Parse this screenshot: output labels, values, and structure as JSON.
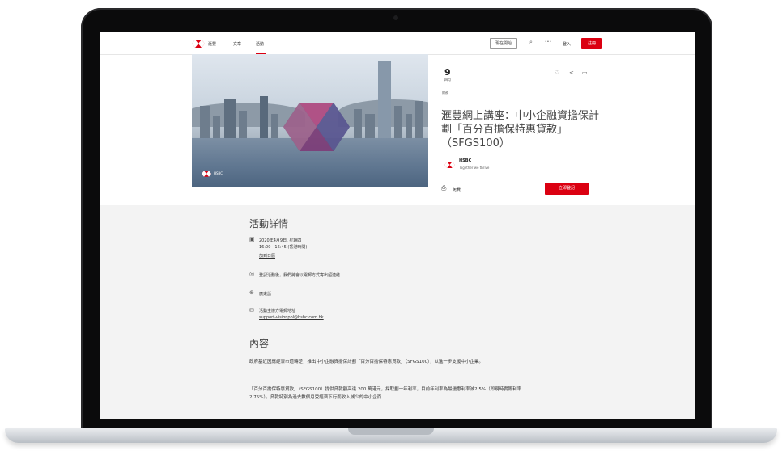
{
  "nav": {
    "brand": "滙豐",
    "items": [
      "文章",
      "活動"
    ],
    "active_item": "活動",
    "start_button": "現在開始",
    "more": "···",
    "login": "登入",
    "register": "註冊"
  },
  "hero": {
    "logo_text": "HSBC"
  },
  "event": {
    "day": "9",
    "month": "四月",
    "category": "財務",
    "title": "滙豐網上講座：中小企融資擔保計劃「百分百擔保特惠貸款」（SFGS100）",
    "organizer_name": "HSBC",
    "organizer_tagline": "Together we thrive",
    "price": "免費",
    "signup_button": "立即登記"
  },
  "details": {
    "heading": "活動詳情",
    "date": "2020年4月9日, 星期四",
    "time": "16:00 - 16:45 (香港時間)",
    "calendar_link": "加到日曆",
    "location": "登記活動後，我們將會以電郵方式寄出超連結",
    "language": "廣東話",
    "contact_label": "活動主辦方電郵地址",
    "contact_email": "support-visionpol@hsbc.com.hk"
  },
  "content": {
    "heading": "內容",
    "para1": "政府基近因應經濟市道轉差，推出中小企融資擔保計劃「百分百擔保特惠貸款」（SFGS100），以進一步支援中小企業。",
    "para2": "「百分百擔保特惠貸款」（SFGS100）提供貸款額高達 200 萬港元，採取劃一年利率，目前年利率為最優惠利率減2.5%（即現時實際利率2.75%）。貸款特別為過去數個月受經濟下行而收入減少的中小企而"
  },
  "colors": {
    "brand_red": "#db0011",
    "laptop_bezel": "#0b0b0c"
  }
}
